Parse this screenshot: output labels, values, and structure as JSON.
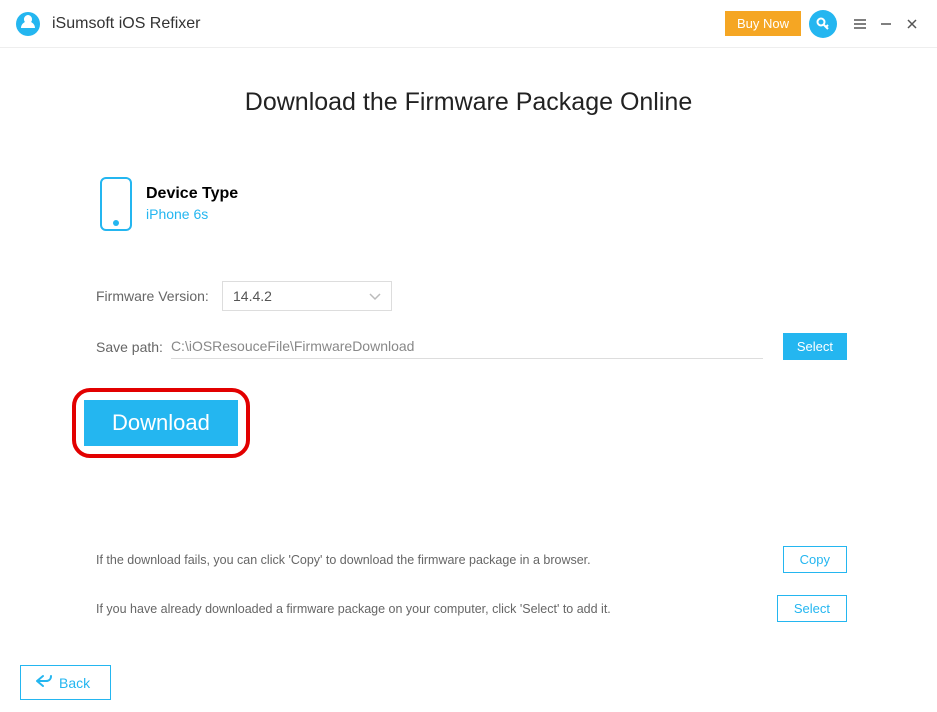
{
  "titlebar": {
    "app_name": "iSumsoft iOS Refixer",
    "buy_label": "Buy Now"
  },
  "page": {
    "title": "Download the Firmware Package Online"
  },
  "device": {
    "label": "Device Type",
    "name": "iPhone 6s"
  },
  "firmware": {
    "label": "Firmware Version:",
    "selected": "14.4.2"
  },
  "save": {
    "label": "Save path:",
    "path": "C:\\iOSResouceFile\\FirmwareDownload",
    "button": "Select"
  },
  "download": {
    "label": "Download"
  },
  "hints": {
    "copy_text": "If the download fails, you can click 'Copy' to download the firmware package in a browser.",
    "copy_btn": "Copy",
    "select_text": "If you have already downloaded a firmware package on your computer, click 'Select' to add it.",
    "select_btn": "Select"
  },
  "back": {
    "label": "Back"
  }
}
